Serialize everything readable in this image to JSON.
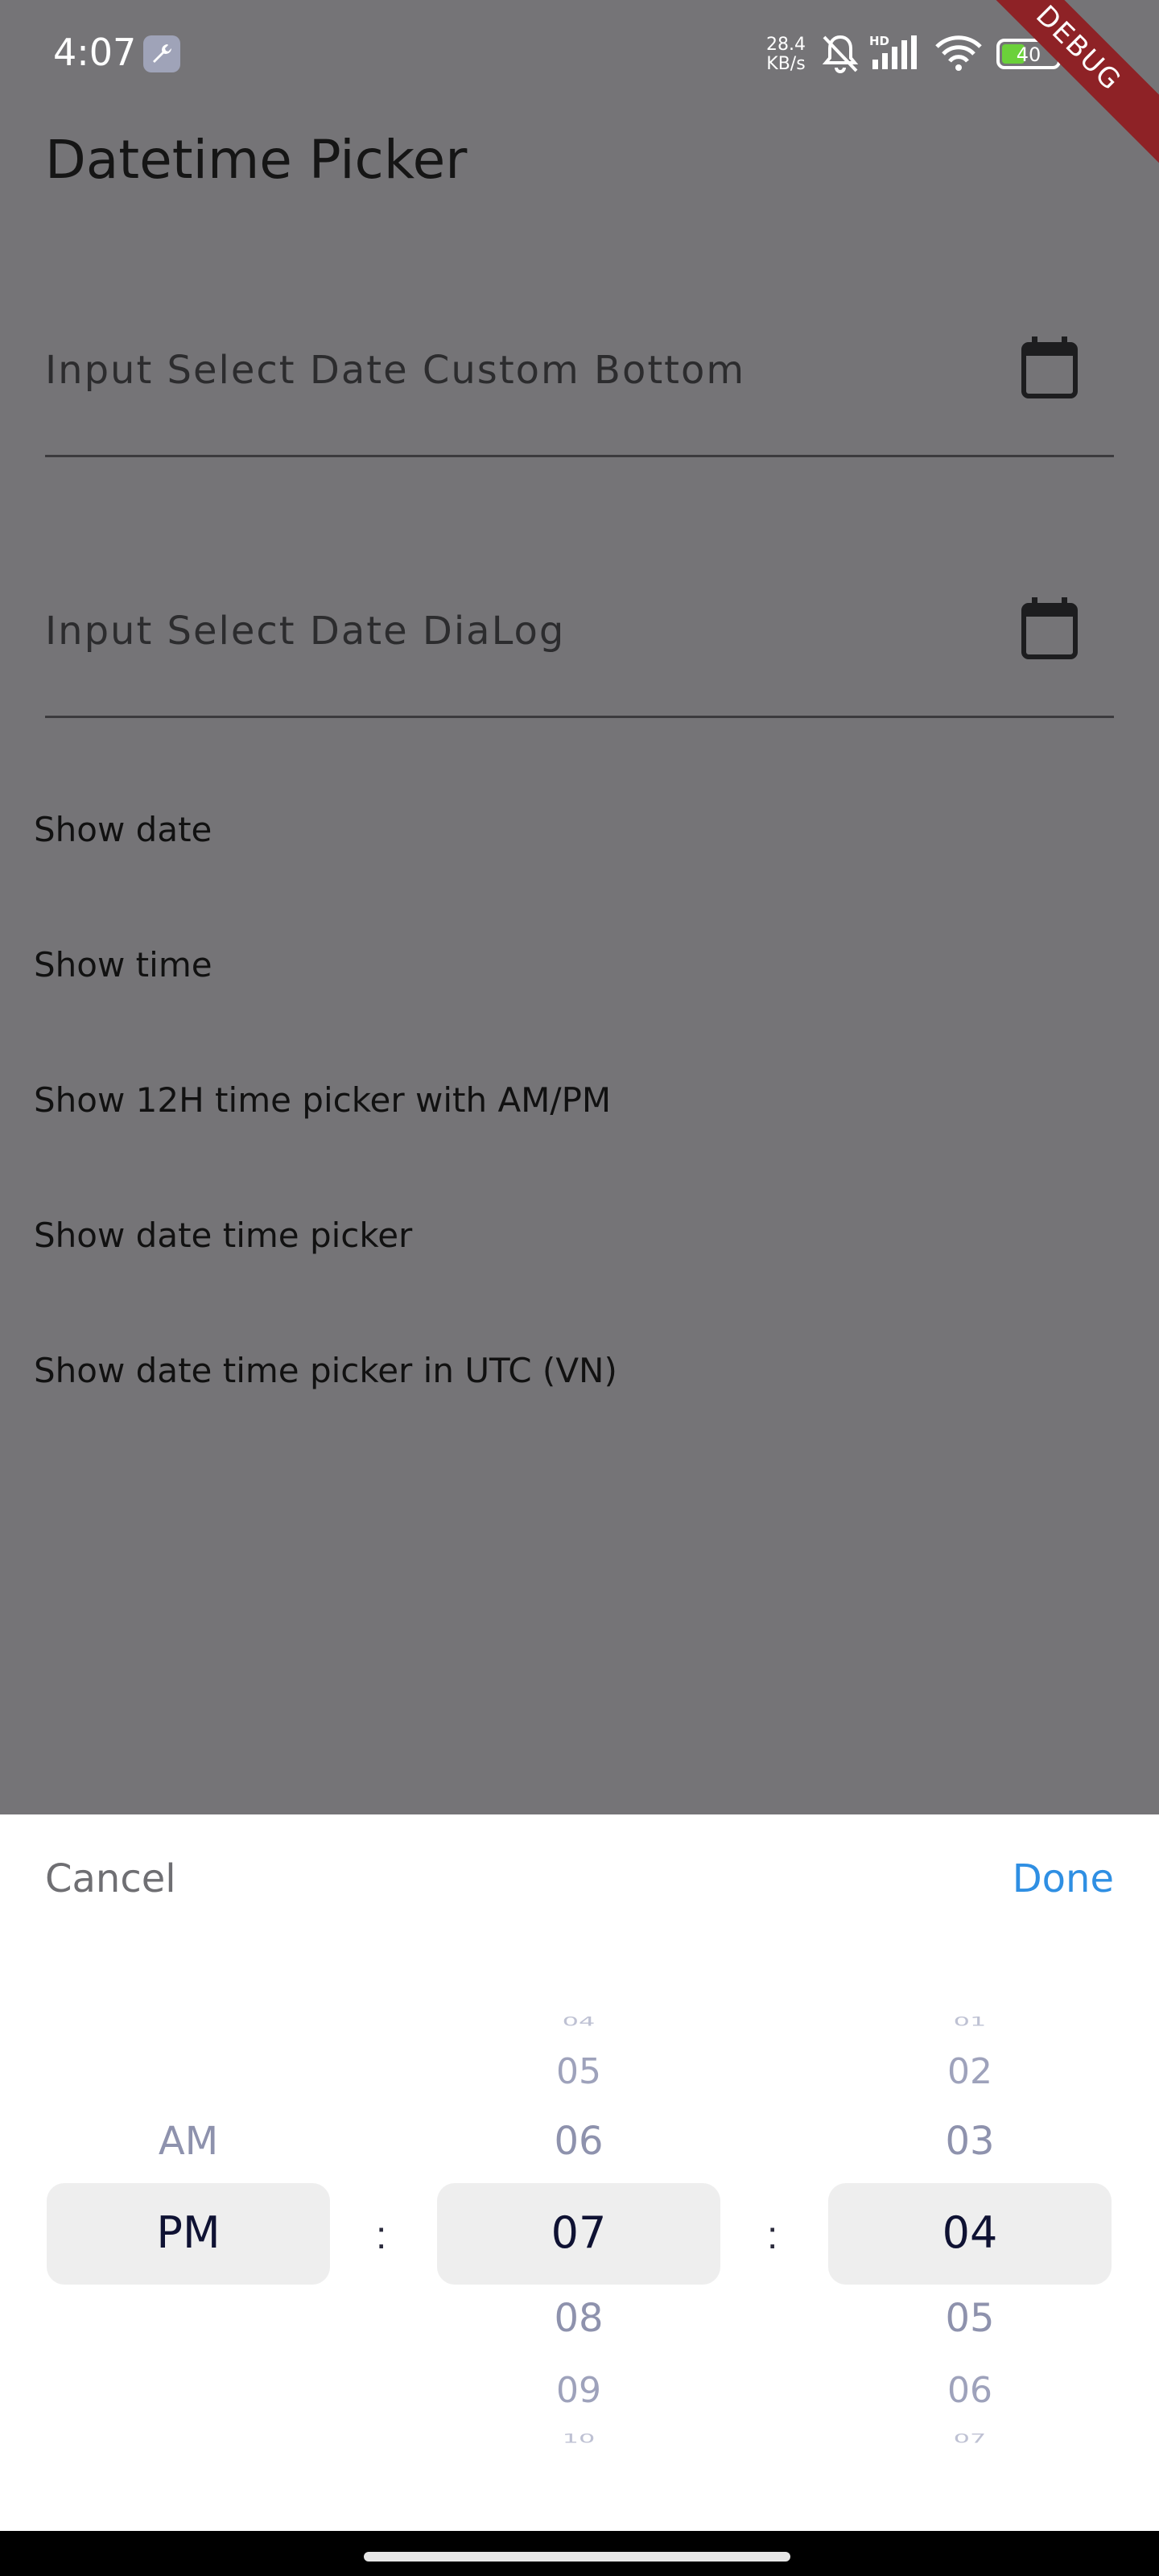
{
  "status_bar": {
    "time": "4:07",
    "net_speed_value": "28.4",
    "net_speed_unit": "KB/s",
    "battery": "40",
    "icons": [
      "wrench-icon",
      "bell-off-icon",
      "hd-signal-icon",
      "wifi-icon",
      "battery-icon"
    ],
    "battery_color": "#6bd13a"
  },
  "debug_banner": "DEBUG",
  "page": {
    "title": "Datetime Picker",
    "inputs": [
      {
        "label": "Input Select Date Custom Bottom",
        "icon": "calendar-icon"
      },
      {
        "label": "Input Select Date DiaLog",
        "icon": "calendar-icon"
      }
    ],
    "menu": [
      "Show date",
      "Show time",
      "Show 12H time picker with AM/PM",
      "Show date time picker",
      "Show date time picker in UTC (VN)"
    ]
  },
  "picker": {
    "cancel": "Cancel",
    "done": "Done",
    "done_color": "#2f8fe3",
    "separator": ":",
    "period": {
      "above": [
        "AM"
      ],
      "selected": "PM",
      "below": []
    },
    "hour": {
      "above": [
        "04",
        "05",
        "06"
      ],
      "selected": "07",
      "below": [
        "08",
        "09",
        "10"
      ]
    },
    "minute": {
      "above": [
        "01",
        "02",
        "03"
      ],
      "selected": "04",
      "below": [
        "05",
        "06",
        "07"
      ]
    }
  }
}
